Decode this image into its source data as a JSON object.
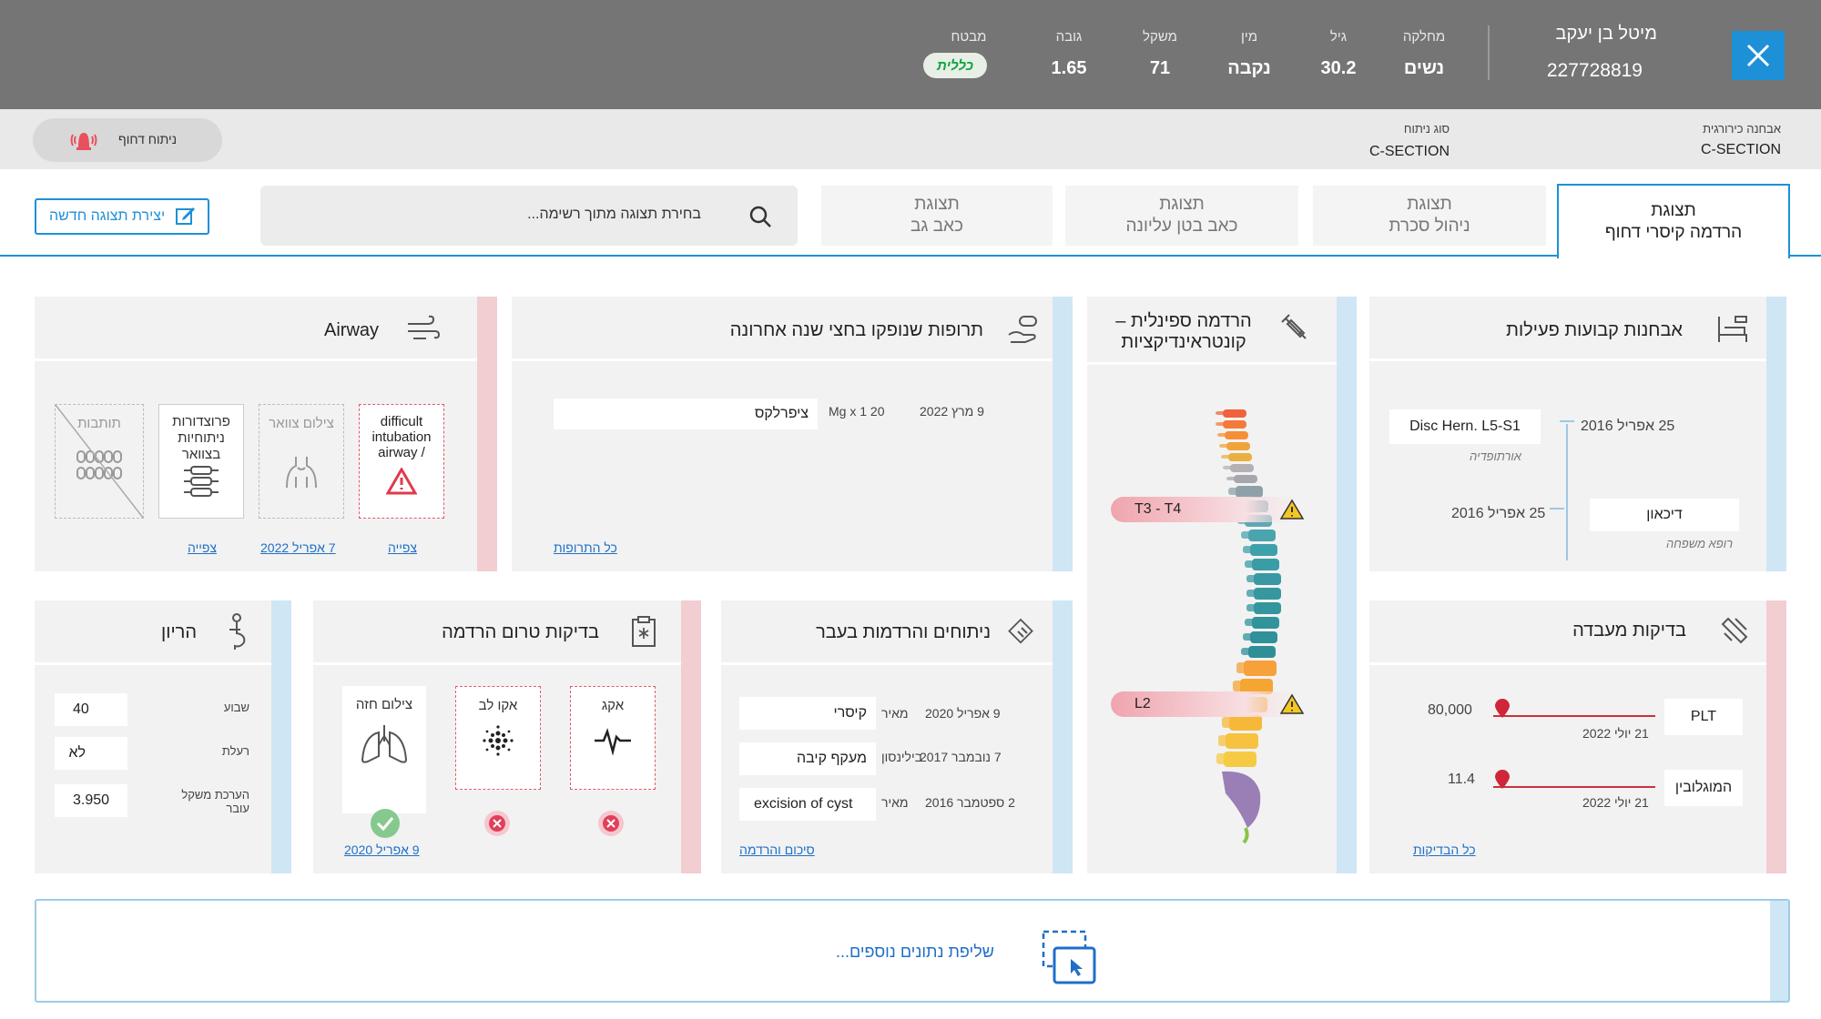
{
  "header": {
    "patient_name": "מיטל בן יעקב",
    "patient_id": "227728819",
    "fields": [
      {
        "label": "מחלקה",
        "value": "נשים"
      },
      {
        "label": "גיל",
        "value": "30.2"
      },
      {
        "label": "מין",
        "value": "נקבה"
      },
      {
        "label": "משקל",
        "value": "71"
      },
      {
        "label": "גובה",
        "value": "1.65"
      },
      {
        "label": "מבטח",
        "value": "כללית"
      }
    ]
  },
  "subbar": {
    "surgical_dx_label": "אבחנה כירורגית",
    "surgical_dx_value": "C-SECTION",
    "surgery_type_label": "סוג ניתוח",
    "surgery_type_value": "C-SECTION",
    "urgent_label": "ניתוח דחוף"
  },
  "tabs": [
    {
      "line1": "תצוגת",
      "line2": "הרדמה קיסרי דחוף"
    },
    {
      "line1": "תצוגת",
      "line2": "ניהול סכרת"
    },
    {
      "line1": "תצוגת",
      "line2": "כאב בטן עליונה"
    },
    {
      "line1": "תצוגת",
      "line2": "כאב גב"
    }
  ],
  "search": {
    "placeholder": "בחירת תצוגה מתוך רשימה..."
  },
  "new_view_button": "יצירת תצוגה חדשה",
  "diagnoses": {
    "title": "אבחנות קבועות פעילות",
    "items": [
      {
        "date": "25 אפריל 2016",
        "diagnosis": "Disc Hern.  L5-S1",
        "source": "אורתופדיה"
      },
      {
        "date": "25 אפריל 2016",
        "diagnosis": "דיכאון",
        "source": "רופא משפחה"
      }
    ]
  },
  "spine": {
    "title_line1": "הרדמה ספינלית –",
    "title_line2": "קונטראינדיקציות",
    "markers": [
      "T3 - T4",
      "L2"
    ]
  },
  "meds": {
    "title": "תרופות שנופקו בחצי שנה אחרונה",
    "items": [
      {
        "date": "9 מרץ 2022",
        "dose": "Mg x 1 20",
        "name": "ציפרלקס"
      }
    ],
    "link": "כל התרופות"
  },
  "airway": {
    "title": "Airway",
    "tiles": [
      {
        "label": "difficult intubation airway /",
        "link": "צפייה"
      },
      {
        "label": "צילום צוואר",
        "link": "7 אפריל 2022"
      },
      {
        "label": "פרוצדורות ניתוחיות בצוואר",
        "link": "צפייה"
      },
      {
        "label": "תותבות",
        "link": ""
      }
    ]
  },
  "labs": {
    "title": "בדיקות מעבדה",
    "items": [
      {
        "name": "PLT",
        "value": "80,000",
        "date": "21 יולי 2022"
      },
      {
        "name": "המוגלובין",
        "value": "11.4",
        "date": "21 יולי 2022"
      }
    ],
    "link": "כל הבדיקות"
  },
  "surgeries": {
    "title": "ניתוחים והרדמות בעבר",
    "items": [
      {
        "date": "9 אפריל 2020",
        "hospital": "מאיר",
        "name": "קיסרי"
      },
      {
        "date": "7 נובמבר 2017",
        "hospital": "בילינסון",
        "name": "מעקף קיבה"
      },
      {
        "date": "2 ספטמבר 2016",
        "hospital": "מאיר",
        "name": "excision of cyst"
      }
    ],
    "link": "סיכום והרדמה"
  },
  "preop": {
    "title": "בדיקות טרום הרדמה",
    "tests": [
      {
        "name": "אקג",
        "status": "missing"
      },
      {
        "name": "אקו לב",
        "status": "missing"
      },
      {
        "name": "צילום חזה",
        "status": "done"
      }
    ],
    "link": "9 אפריל 2020"
  },
  "pregnancy": {
    "title": "הריון",
    "rows": [
      {
        "label": "שבוע",
        "value": "40"
      },
      {
        "label": "רעלת",
        "value": "לא"
      },
      {
        "label": "הערכת משקל עובר",
        "value": "3.950"
      }
    ]
  },
  "more_data": "שליפת נתונים נוספים..."
}
